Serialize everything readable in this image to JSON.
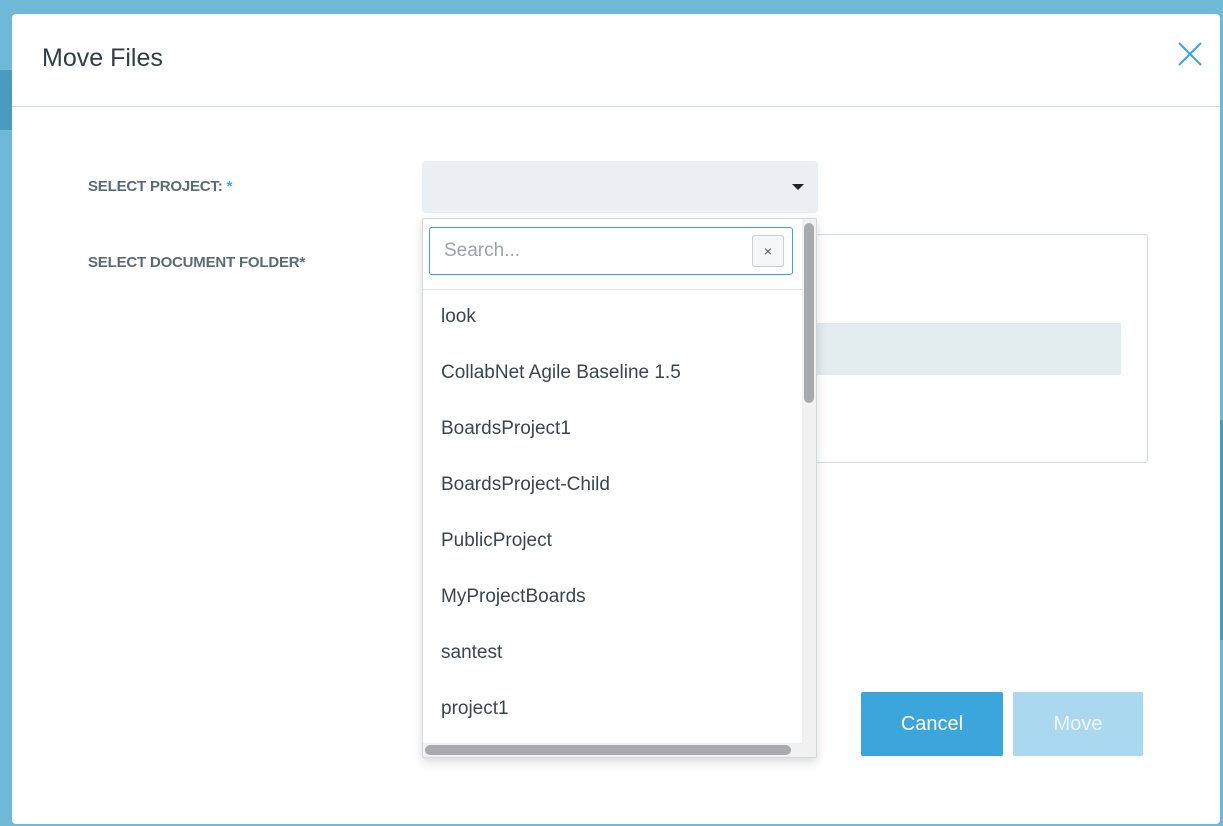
{
  "dialog": {
    "title": "Move Files",
    "close_icon": "close-icon"
  },
  "form": {
    "project_label": "SELECT PROJECT:",
    "folder_label": "SELECT DOCUMENT FOLDER",
    "required_mark": "*",
    "project_selected_value": ""
  },
  "dropdown": {
    "search_placeholder": "Search...",
    "search_value": "",
    "clear_label": "×",
    "options": [
      "look",
      "CollabNet Agile Baseline 1.5",
      "BoardsProject1",
      "BoardsProject-Child",
      "PublicProject",
      "MyProjectBoards",
      "santest",
      "project1"
    ]
  },
  "actions": {
    "cancel_label": "Cancel",
    "move_label": "Move"
  },
  "colors": {
    "accent": "#3aa6dc",
    "disabled_button": "#aad8ee",
    "backdrop": "#6fb9d8"
  }
}
